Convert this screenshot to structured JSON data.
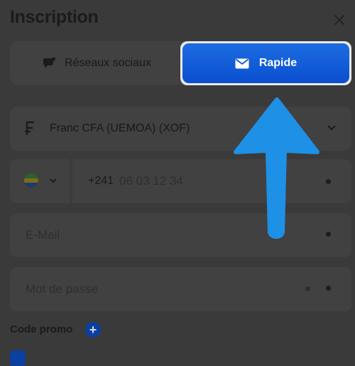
{
  "header": {
    "title": "Inscription"
  },
  "tabs": {
    "social_label": "Réseaux sociaux",
    "rapide_label": "Rapide",
    "active": "Rapide"
  },
  "form": {
    "currency_value": "Franc CFA (UEMOA) (XOF)",
    "phone_code": "+241",
    "phone_placeholder": "06 03 12 34",
    "email_placeholder": "E-Mail",
    "password_placeholder": "Mot de passe"
  },
  "promo": {
    "label": "Code promo"
  },
  "colors": {
    "accent": "#0a55d6",
    "arrow": "#1e90e6",
    "overlay": "#3a3a3a"
  },
  "icons": {
    "social": "chat-bubble-icon",
    "rapide": "envelope-icon",
    "currency": "franc-icon",
    "flag": "gabon-flag-icon"
  }
}
